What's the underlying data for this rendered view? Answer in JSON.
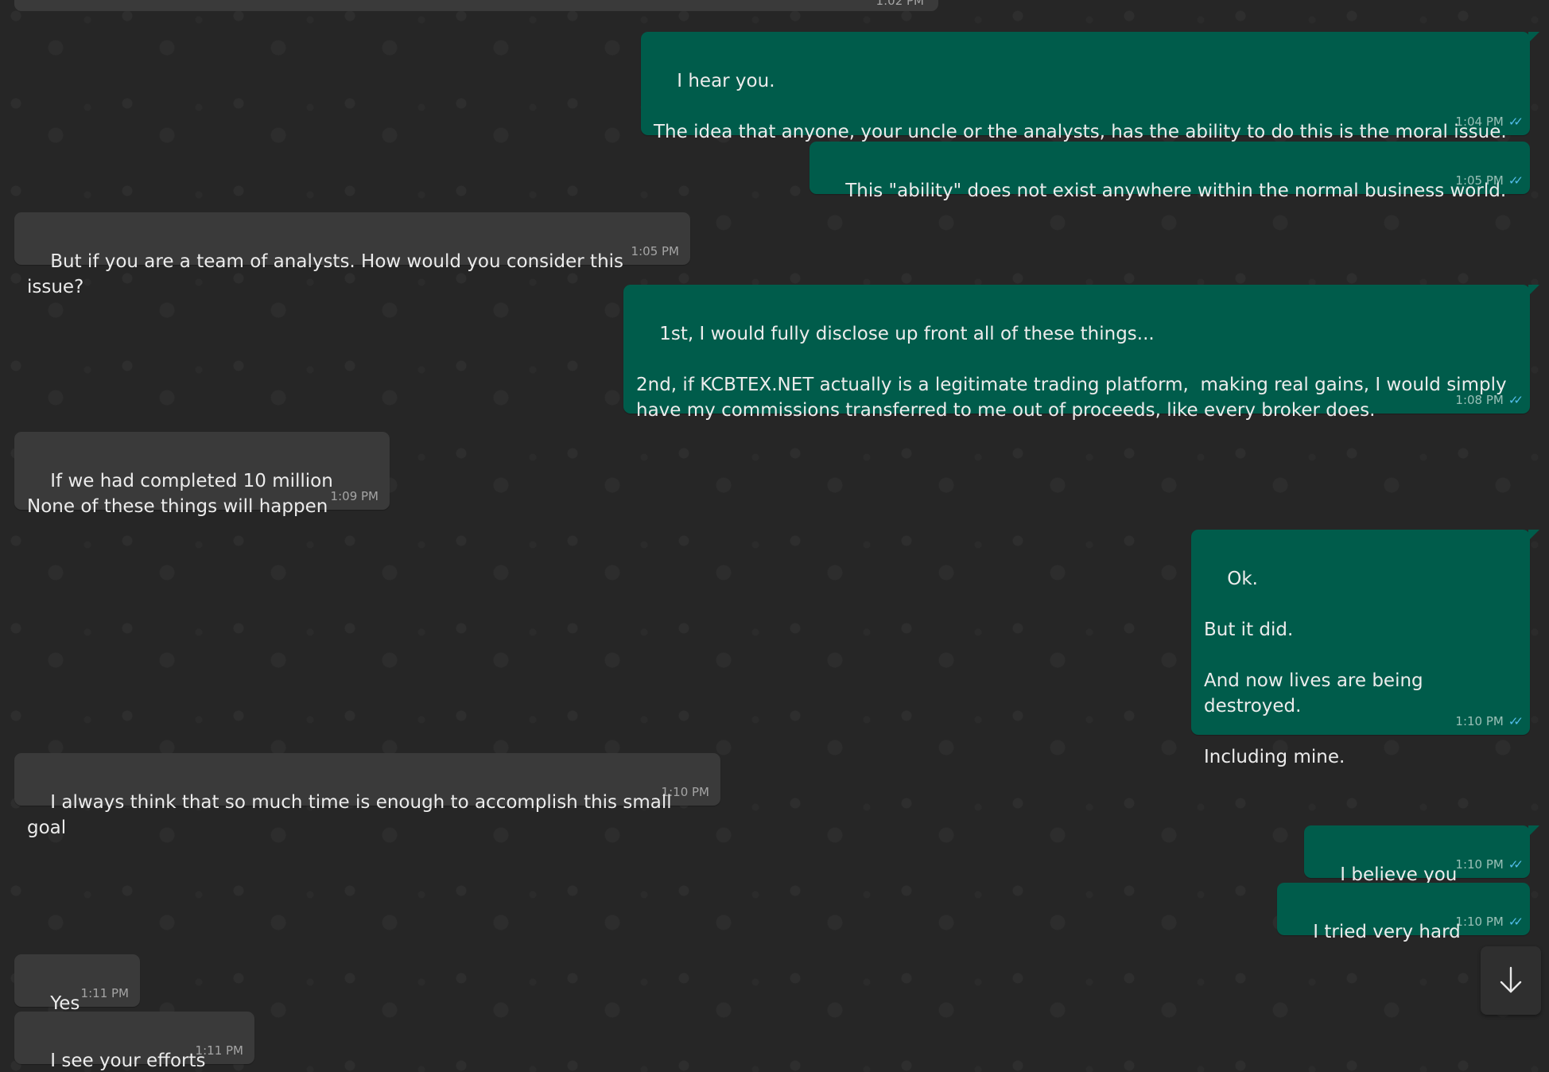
{
  "top_partial_message": {
    "time": "1:02 PM"
  },
  "messages": [
    {
      "direction": "outgoing",
      "text": "I hear you.\n\nThe idea that anyone, your uncle or the analysts, has the ability to do this is the moral issue.",
      "time": "1:04 PM",
      "status": "read"
    },
    {
      "direction": "outgoing",
      "text": "This \"ability\" does not exist anywhere within the normal business world.",
      "time": "1:05 PM",
      "status": "read"
    },
    {
      "direction": "incoming",
      "text": "But if you are a team of analysts. How would you consider this issue?",
      "time": "1:05 PM"
    },
    {
      "direction": "outgoing",
      "text": "1st, I would fully disclose up front all of these things...\n\n2nd, if KCBTEX.NET actually is a legitimate trading platform,  making real gains, I would simply have my commissions transferred to me out of proceeds, like every broker does.",
      "time": "1:08 PM",
      "status": "read"
    },
    {
      "direction": "incoming",
      "text": "If we had completed 10 million\nNone of these things will happen",
      "time": "1:09 PM"
    },
    {
      "direction": "outgoing",
      "text": "Ok.\n\nBut it did.\n\nAnd now lives are being destroyed.\n\nIncluding mine.",
      "time": "1:10 PM",
      "status": "read"
    },
    {
      "direction": "incoming",
      "text": "I always think that so much time is enough to accomplish this small goal",
      "time": "1:10 PM"
    },
    {
      "direction": "outgoing",
      "text": "I believe you",
      "time": "1:10 PM",
      "status": "read"
    },
    {
      "direction": "outgoing",
      "text": "I tried very hard",
      "time": "1:10 PM",
      "status": "read"
    },
    {
      "direction": "incoming",
      "text": "Yes",
      "time": "1:11 PM"
    },
    {
      "direction": "incoming",
      "text": "I see your efforts",
      "time": "1:11 PM"
    }
  ],
  "read_tick_icon": "double-check-icon",
  "scroll_button": {
    "icon": "arrow-down-icon"
  },
  "colors": {
    "background": "#262626",
    "incoming_bubble": "#3a3a3a",
    "outgoing_bubble": "#005c4b",
    "read_tick": "#53bdeb",
    "text": "#ececec"
  }
}
